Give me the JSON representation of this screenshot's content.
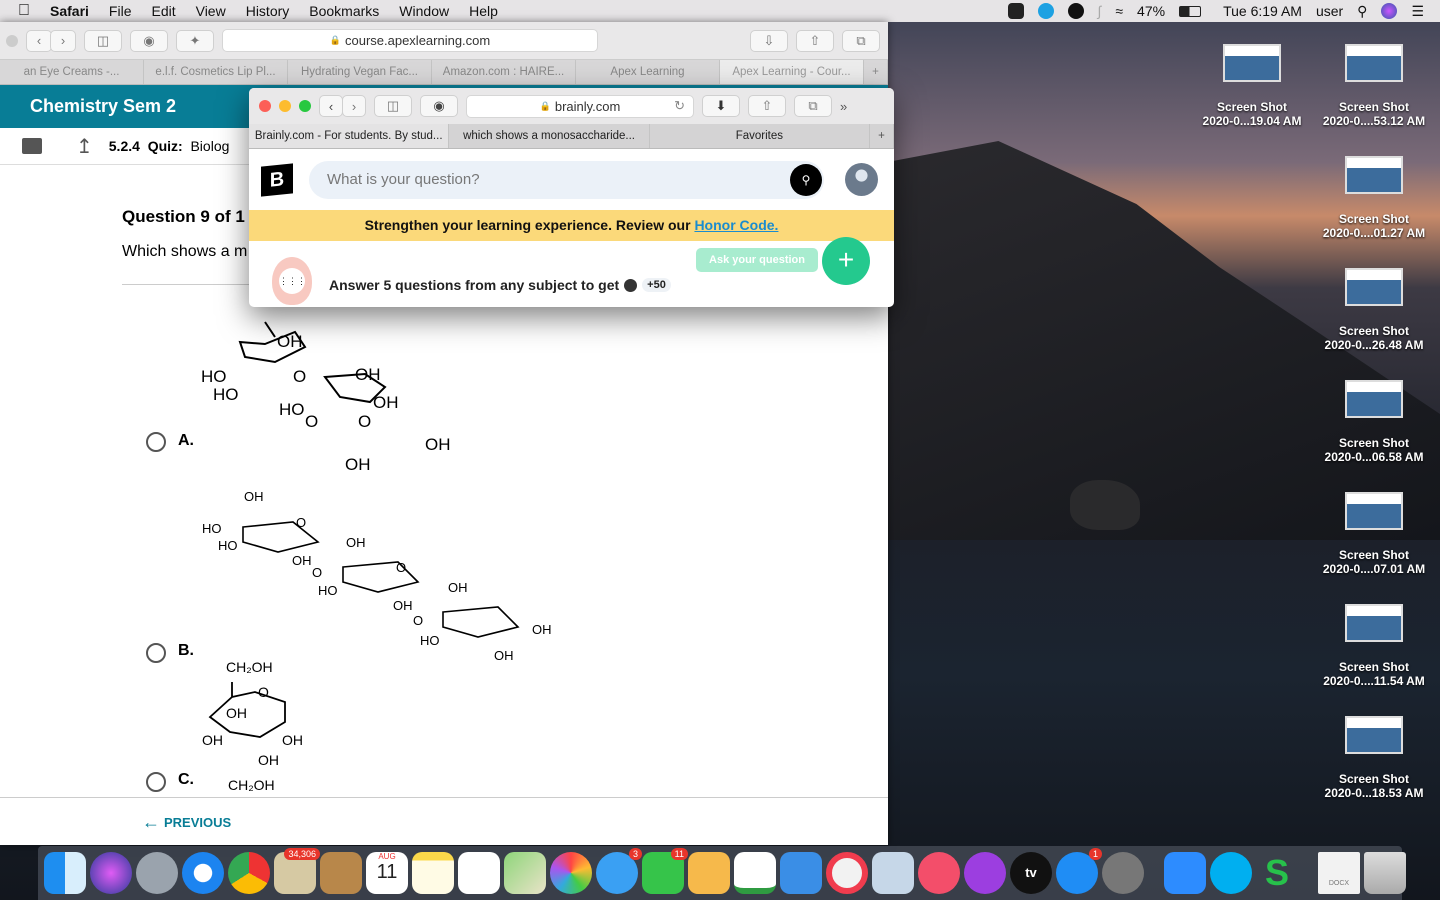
{
  "menubar": {
    "app": "Safari",
    "items": [
      "File",
      "Edit",
      "View",
      "History",
      "Bookmarks",
      "Window",
      "Help"
    ],
    "battery": "47%",
    "clock": "Tue 6:19 AM",
    "user": "user"
  },
  "desktop_icons": [
    {
      "label1": "Screen Shot",
      "label2": "2020-0...19.04 AM"
    },
    {
      "label1": "Screen Shot",
      "label2": "2020-0....53.12 AM"
    },
    {
      "label1": "Screen Shot",
      "label2": "2020-0....01.27 AM"
    },
    {
      "label1": "Screen Shot",
      "label2": "2020-0...26.48 AM"
    },
    {
      "label1": "Screen Shot",
      "label2": "2020-0...06.58 AM"
    },
    {
      "label1": "Screen Shot",
      "label2": "2020-0....07.01 AM"
    },
    {
      "label1": "Screen Shot",
      "label2": "2020-0....11.54 AM"
    },
    {
      "label1": "Screen Shot",
      "label2": "2020-0...18.53 AM"
    }
  ],
  "apex": {
    "url": "course.apexlearning.com",
    "tabs": [
      "an Eye Creams -...",
      "e.l.f. Cosmetics Lip Pl...",
      "Hydrating Vegan Fac...",
      "Amazon.com : HAIRE...",
      "Apex Learning",
      "Apex Learning - Cour..."
    ],
    "course": "Chemistry Sem 2",
    "quiz_num": "5.2.4",
    "quiz_label": "Quiz:",
    "quiz_title": "Biolog",
    "question_heading": "Question 9 of 1",
    "question_text": "Which shows a m",
    "options": [
      "A.",
      "B.",
      "C."
    ],
    "previous": "PREVIOUS",
    "mol_a": [
      "OH",
      "HO",
      "HO",
      "HO",
      "O",
      "O",
      "OH",
      "OH",
      "O",
      "OH",
      "OH"
    ],
    "mol_b": [
      "OH",
      "HO",
      "HO",
      "O",
      "OH",
      "OH",
      "O",
      "HO",
      "OH",
      "O",
      "OH",
      "O",
      "HO",
      "OH",
      "OH"
    ],
    "mol_c": [
      "CH₂OH",
      "O",
      "OH",
      "OH",
      "OH",
      "OH",
      "CH₂OH"
    ]
  },
  "brainly": {
    "url": "brainly.com",
    "tabs": [
      "Brainly.com - For students. By stud...",
      "which shows a monosaccharide...",
      "Favorites"
    ],
    "search_placeholder": "What is your question?",
    "banner_text": "Strengthen your learning experience. Review our",
    "banner_link": "Honor Code.",
    "promo": "Answer 5 questions from any subject to get",
    "points": "+50",
    "ask_button": "Ask your question",
    "logo": "B"
  },
  "dock": {
    "mail_badge": "34,306",
    "calendar_month": "AUG",
    "calendar_day": "11",
    "messages_badge": "3",
    "facetime_badge": "11",
    "appstore_badge": "1",
    "tv_label": "tv",
    "docx_label": "DOCX"
  },
  "colors": {
    "apex_teal": "#087d96",
    "brainly_yellow": "#fbd97a",
    "brainly_green": "#24c98e",
    "link_blue": "#1a8ccf"
  }
}
